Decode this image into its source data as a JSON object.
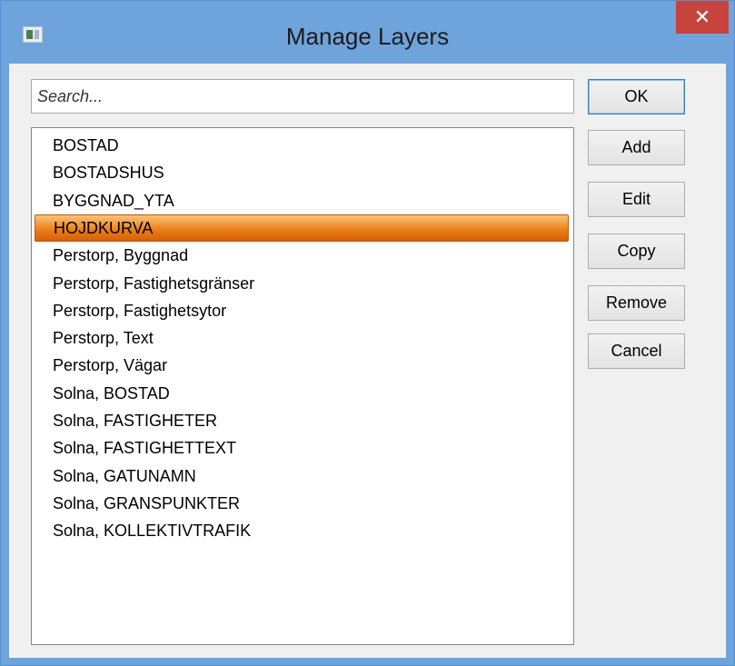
{
  "window": {
    "title": "Manage Layers",
    "close_label": "✕",
    "icon": "app-window-icon",
    "accent_color": "#6fa3dc",
    "close_color": "#c7443e"
  },
  "search": {
    "placeholder": "Search...",
    "value": ""
  },
  "layers": {
    "selected_index": 3,
    "selection_color": "#f29a3c",
    "items": [
      "BOSTAD",
      "BOSTADSHUS",
      "BYGGNAD_YTA",
      "HOJDKURVA",
      "Perstorp, Byggnad",
      "Perstorp, Fastighetsgränser",
      "Perstorp, Fastighetsytor",
      "Perstorp, Text",
      "Perstorp, Vägar",
      "Solna, BOSTAD",
      "Solna, FASTIGHETER",
      "Solna, FASTIGHETTEXT",
      "Solna, GATUNAMN",
      "Solna, GRANSPUNKTER",
      "Solna, KOLLEKTIVTRAFIK"
    ]
  },
  "buttons": {
    "ok": "OK",
    "add": "Add",
    "edit": "Edit",
    "copy": "Copy",
    "remove": "Remove",
    "cancel": "Cancel"
  }
}
